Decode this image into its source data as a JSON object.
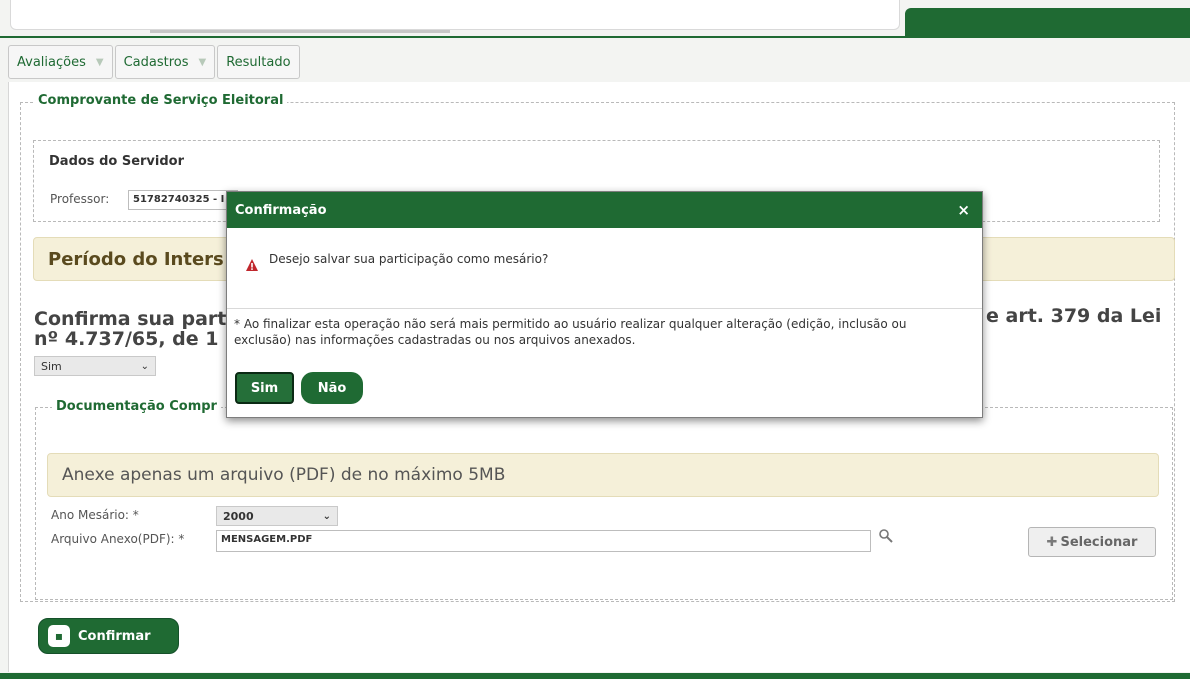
{
  "menu": {
    "items": [
      {
        "label": "Avaliações",
        "has_caret": true
      },
      {
        "label": "Cadastros",
        "has_caret": true
      },
      {
        "label": "Resultado",
        "has_caret": false
      }
    ]
  },
  "form": {
    "legend": "Comprovante de Serviço Eleitoral",
    "servidor": {
      "title": "Dados do Servidor",
      "professor_label": "Professor:",
      "professor_value": "51782740325 - I"
    },
    "periodo": {
      "title": "Período do Inters"
    },
    "question": {
      "line1_left": "Confirma sua part",
      "line1_right": "e art. 379 da Lei",
      "line2": "nº 4.737/65, de 1",
      "select_value": "Sim"
    },
    "documentacao": {
      "legend": "Documentação Compr",
      "notice": "Anexe apenas um arquivo (PDF) de no máximo 5MB",
      "ano_label": "Ano Mesário: *",
      "ano_value": "2000",
      "arquivo_label": "Arquivo Anexo(PDF): *",
      "arquivo_value": "MENSAGEM.PDF",
      "selecionar_label": "Selecionar"
    },
    "confirmar_label": "Confirmar"
  },
  "modal": {
    "title": "Confirmação",
    "close_glyph": "×",
    "message": "Desejo salvar sua participação como mesário?",
    "note": "* Ao finalizar esta operação não será mais permitido ao usuário realizar qualquer alteração (edição, inclusão ou exclusão) nas informações cadastradas ou nos arquivos anexados.",
    "sim_label": "Sim",
    "nao_label": "Não"
  },
  "colors": {
    "primary_green": "#1f6a33",
    "notice_bg": "#f5f0d9",
    "warning_red": "#c0272d"
  }
}
